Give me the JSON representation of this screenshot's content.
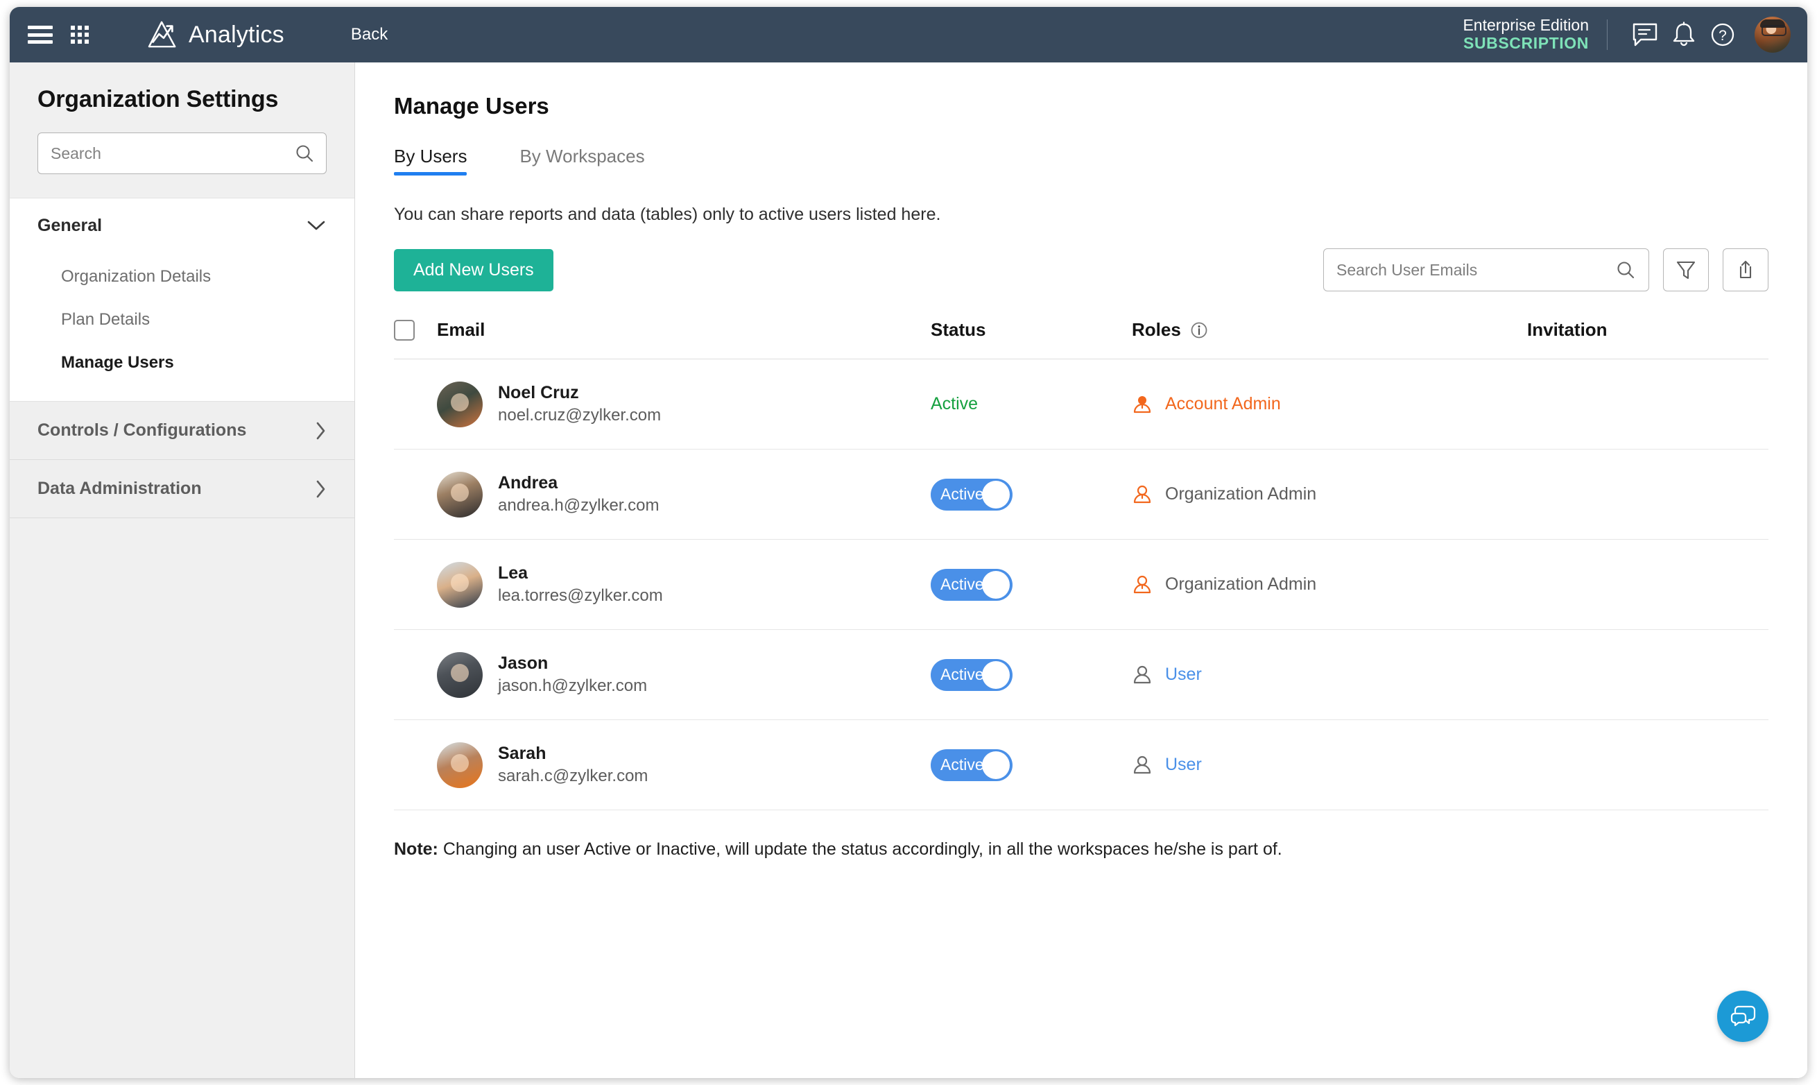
{
  "topbar": {
    "menu_icon": "hamburger-menu-icon",
    "apps_icon": "grid-apps-icon",
    "brand": "Analytics",
    "back": "Back",
    "edition_line1": "Enterprise Edition",
    "edition_line2": "SUBSCRIPTION",
    "chat_icon": "chat-icon",
    "bell_icon": "notifications-bell-icon",
    "help_icon": "help-question-icon",
    "avatar": "user-avatar",
    "bg_color": "#38495c",
    "subscription_color": "#7ee2b8"
  },
  "sidebar": {
    "title": "Organization Settings",
    "search_placeholder": "Search",
    "search_value": "",
    "groups": [
      {
        "label": "General",
        "expanded": true,
        "items": [
          {
            "label": "Organization Details",
            "active": false
          },
          {
            "label": "Plan Details",
            "active": false
          },
          {
            "label": "Manage Users",
            "active": true
          }
        ]
      },
      {
        "label": "Controls / Configurations",
        "expanded": false,
        "items": []
      },
      {
        "label": "Data Administration",
        "expanded": false,
        "items": []
      }
    ]
  },
  "main": {
    "page_title": "Manage Users",
    "tabs": [
      {
        "label": "By Users",
        "active": true
      },
      {
        "label": "By Workspaces",
        "active": false
      }
    ],
    "helper_text": "You can share reports and data (tables) only to active users listed here.",
    "add_users_button": "Add New Users",
    "user_search_placeholder": "Search User Emails",
    "user_search_value": "",
    "filter_icon": "filter-funnel-icon",
    "export_icon": "export-share-icon",
    "accent_color": "#1eb297",
    "table": {
      "columns": [
        "Email",
        "Status",
        "Roles",
        "Invitation"
      ],
      "roles_info_icon": "info-icon",
      "select_all_checked": false,
      "rows": [
        {
          "name": "Noel Cruz",
          "email": "noel.cruz@zylker.com",
          "status_type": "text",
          "status": "Active",
          "role": "Account Admin",
          "role_style": "admin",
          "role_icon": "person-filled-icon",
          "invitation": ""
        },
        {
          "name": "Andrea",
          "email": "andrea.h@zylker.com",
          "status_type": "toggle",
          "status": "Active",
          "role": "Organization Admin",
          "role_style": "org",
          "role_icon": "person-outline-orange-icon",
          "invitation": ""
        },
        {
          "name": "Lea",
          "email": "lea.torres@zylker.com",
          "status_type": "toggle",
          "status": "Active",
          "role": "Organization Admin",
          "role_style": "org",
          "role_icon": "person-outline-orange-icon",
          "invitation": ""
        },
        {
          "name": "Jason",
          "email": "jason.h@zylker.com",
          "status_type": "toggle",
          "status": "Active",
          "role": "User",
          "role_style": "user",
          "role_icon": "person-outline-gray-icon",
          "invitation": ""
        },
        {
          "name": "Sarah",
          "email": "sarah.c@zylker.com",
          "status_type": "toggle",
          "status": "Active",
          "role": "User",
          "role_style": "user",
          "role_icon": "person-outline-gray-icon",
          "invitation": ""
        }
      ]
    },
    "note_label": "Note:",
    "note_text": " Changing an user Active or Inactive, will update the status accordingly, in all the workspaces he/she is part of.",
    "fab_icon": "chat-bubbles-icon",
    "fab_color": "#1c9ad6"
  }
}
